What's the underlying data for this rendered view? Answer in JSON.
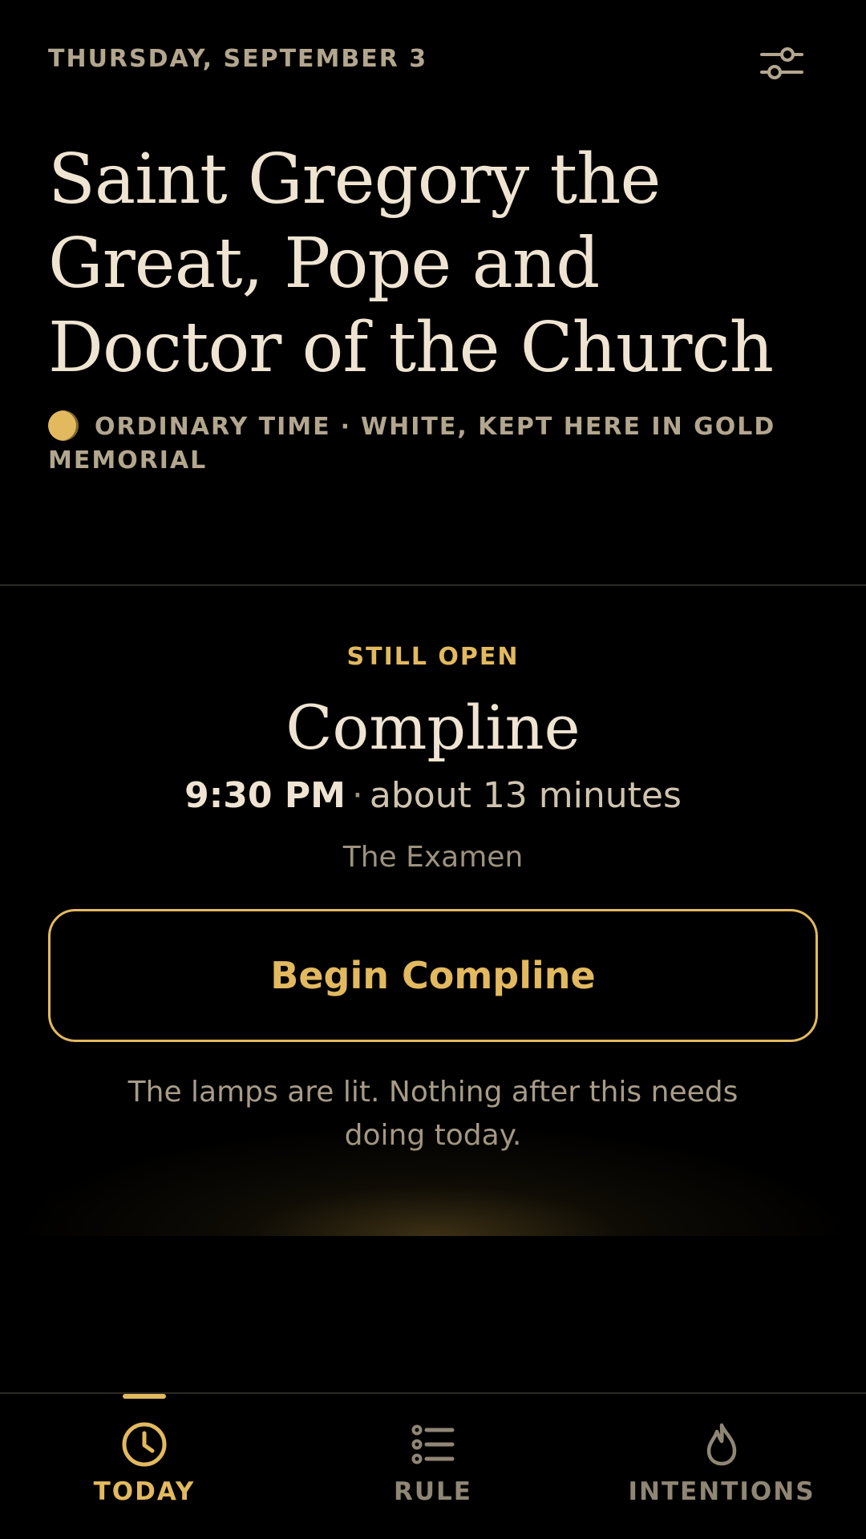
{
  "header": {
    "date": "THURSDAY, SEPTEMBER 3",
    "settings_icon": "sliders-icon"
  },
  "day": {
    "title": "Saint Gregory the Great, Pope and Doctor of the Church",
    "season": "ORDINARY TIME",
    "separator": "·",
    "color_note": "WHITE, KEPT HERE IN GOLD",
    "rank": "MEMORIAL",
    "season_color": "#e2b95f"
  },
  "current_hour": {
    "status": "STILL OPEN",
    "name": "Compline",
    "time": "9:30 PM",
    "separator": "·",
    "duration": "about 13 minutes",
    "subtitle": "The Examen",
    "button_label": "Begin Compline",
    "note": "The lamps are lit. Nothing after this needs doing today."
  },
  "nav": {
    "items": [
      {
        "label": "TODAY",
        "icon": "clock-icon",
        "active": true
      },
      {
        "label": "RULE",
        "icon": "list-icon",
        "active": false
      },
      {
        "label": "INTENTIONS",
        "icon": "flame-icon",
        "active": false
      }
    ]
  },
  "colors": {
    "accent": "#e2b95f",
    "background": "#000000",
    "text_primary": "#efe4d2",
    "text_muted": "#b3a68f",
    "nav_inactive": "#8f8675"
  }
}
